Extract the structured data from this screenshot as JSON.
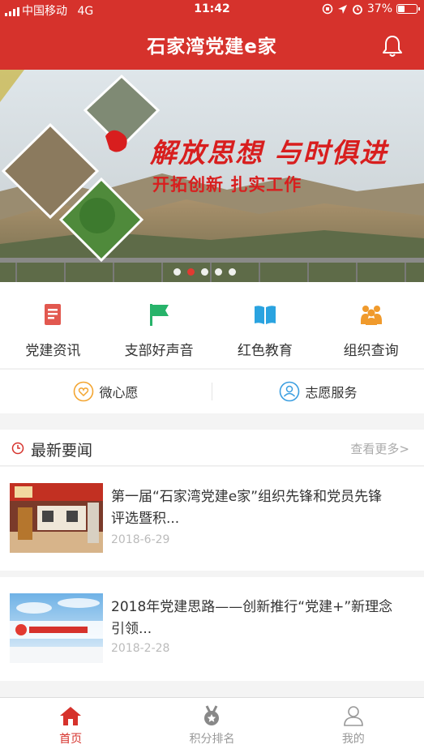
{
  "status_bar": {
    "carrier": "中国移动",
    "network": "4G",
    "time": "11:42",
    "battery": "37%",
    "battery_level": 0.37
  },
  "header": {
    "title": "石家湾党建e家",
    "bell_icon": "bell-icon"
  },
  "banner": {
    "slogan_main": "解放思想 与时俱进",
    "slogan_sub": "开拓创新 扎实工作",
    "slide_count": 5,
    "active_slide": 2
  },
  "grid": [
    {
      "label": "党建资讯",
      "icon": "news-doc-icon",
      "color": "#e2584f"
    },
    {
      "label": "支部好声音",
      "icon": "flag-icon",
      "color": "#27b36a"
    },
    {
      "label": "红色教育",
      "icon": "book-icon",
      "color": "#2aa3e0"
    },
    {
      "label": "组织查询",
      "icon": "group-icon",
      "color": "#f09a2c"
    }
  ],
  "quick_links": [
    {
      "label": "微心愿",
      "icon": "heart-icon",
      "color": "#f3a531"
    },
    {
      "label": "志愿服务",
      "icon": "volunteer-icon",
      "color": "#3a9ee0"
    }
  ],
  "news": {
    "section_title": "最新要闻",
    "more_label": "查看更多>",
    "items": [
      {
        "title": "第一届“石家湾党建e家”组织先锋和党员先锋评选暨积...",
        "date": "2018-6-29"
      },
      {
        "title": "2018年党建思路——创新推行“党建+”新理念引领...",
        "date": "2018-2-28"
      }
    ]
  },
  "tabbar": [
    {
      "label": "首页",
      "icon": "home-icon",
      "active": true
    },
    {
      "label": "积分排名",
      "icon": "medal-icon",
      "active": false
    },
    {
      "label": "我的",
      "icon": "user-icon",
      "active": false
    }
  ],
  "colors": {
    "brand_red": "#d6322c",
    "inactive_gray": "#999999"
  }
}
